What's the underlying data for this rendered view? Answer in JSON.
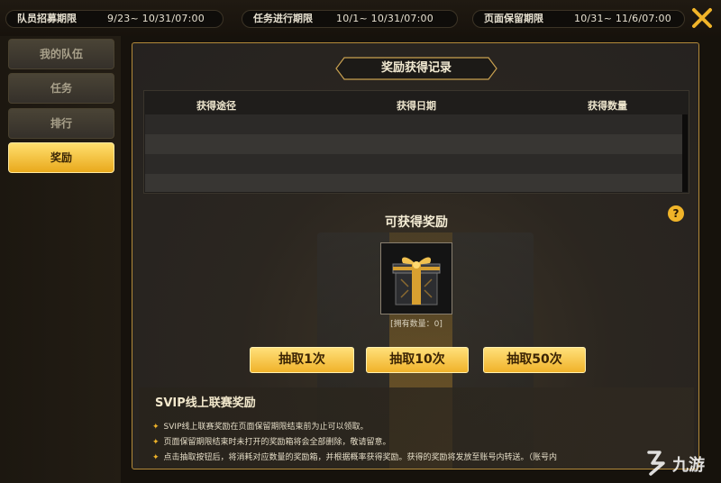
{
  "topbar": {
    "recruit": {
      "label": "队员招募期限",
      "value": "9/23~ 10/31/07:00"
    },
    "task": {
      "label": "任务进行期限",
      "value": "10/1~ 10/31/07:00"
    },
    "keep": {
      "label": "页面保留期限",
      "value": "10/31~ 11/6/07:00"
    },
    "close_icon": "close-icon"
  },
  "nav": {
    "items": [
      {
        "label": "我的队伍",
        "active": false
      },
      {
        "label": "任务",
        "active": false
      },
      {
        "label": "排行",
        "active": false
      },
      {
        "label": "奖励",
        "active": true
      }
    ]
  },
  "records": {
    "title": "奖励获得记录",
    "columns": [
      "获得途径",
      "获得日期",
      "获得数量"
    ],
    "rows": []
  },
  "rewards": {
    "title": "可获得奖励",
    "item_icon": "gift-box-icon",
    "owned": "[拥有数量：0]",
    "help_label": "?"
  },
  "draw_buttons": [
    "抽取1次",
    "抽取10次",
    "抽取50次"
  ],
  "svip": {
    "title": "SVIP线上联赛奖励",
    "rules": [
      "SVIP线上联赛奖励在页面保留期限结束前为止可以领取。",
      "页面保留期限结束时未打开的奖励箱将会全部删除，敬请留意。",
      "点击抽取按钮后，将消耗对应数量的奖励箱，并根据概率获得奖励。获得的奖励将发放至账号内转送。（账号内"
    ]
  },
  "watermark": {
    "text": "九游"
  },
  "colors": {
    "accent_gold": "#f0b429",
    "panel_border": "#b38a3a",
    "active_tab": "#ffdf6e"
  }
}
